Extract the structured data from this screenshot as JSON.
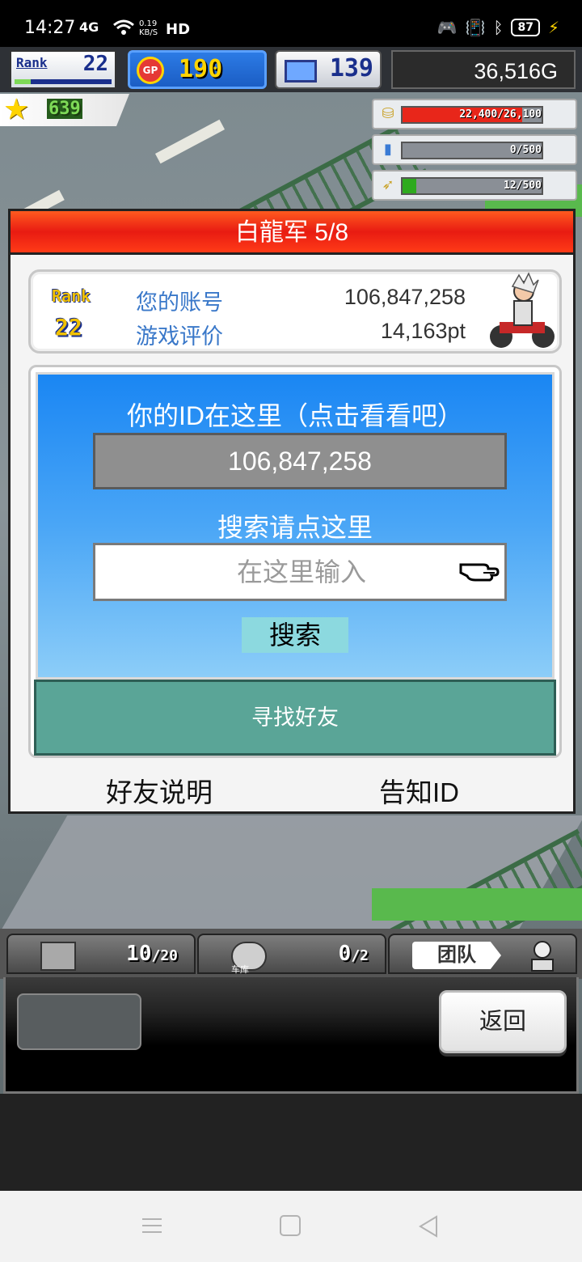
{
  "status_bar": {
    "time": "14:27",
    "signal": "4G",
    "speed_value": "0.19",
    "speed_unit": "KB/S",
    "hd": "HD",
    "battery": "87"
  },
  "hud": {
    "rank_label": "Rank",
    "rank_value": "22",
    "gp_label": "GP",
    "gp_value": "190",
    "pc_value": "139",
    "money": "36,516G",
    "stars": "639",
    "resources": [
      {
        "icon": "coin-stack-icon",
        "text": "22,400/26,100",
        "fill": 0.86,
        "color": "#e8261a"
      },
      {
        "icon": "fuel-bottle-icon",
        "text": "0/500",
        "fill": 0.0,
        "color": "#3a7bd5"
      },
      {
        "icon": "feather-icon",
        "text": "12/500",
        "fill": 0.1,
        "color": "#2eaa1e"
      }
    ]
  },
  "dialog": {
    "title": "白龍军 5/8",
    "rank_label": "Rank",
    "rank_value": "22",
    "account_label": "您的账号",
    "account_value": "106,847,258",
    "rating_label": "游戏评价",
    "rating_value": "14,163pt",
    "id_title": "你的ID在这里（点击看看吧）",
    "id_value": "106,847,258",
    "search_title": "搜索请点这里",
    "search_placeholder": "在这里输入",
    "search_button": "搜索",
    "find_friends": "寻找好友",
    "friend_help": "好友说明",
    "share_id": "告知ID"
  },
  "bottom": {
    "tab1_value": "10",
    "tab1_max": "/20",
    "tab2_label": "车库",
    "tab2_value": "0",
    "tab2_max": "/2",
    "tab3_label": "团队",
    "back": "返回"
  }
}
